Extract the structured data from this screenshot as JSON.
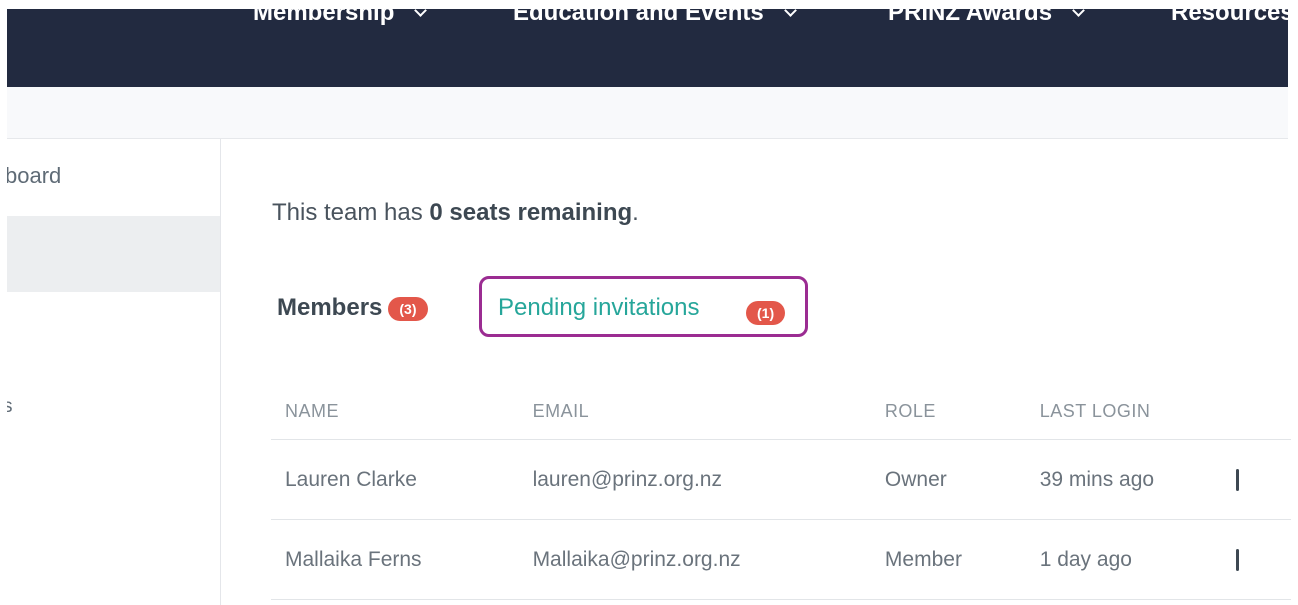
{
  "nav": {
    "items": [
      {
        "label": "Membership"
      },
      {
        "label": "Education and Events"
      },
      {
        "label": "PRINZ Awards"
      },
      {
        "label": "Resources"
      }
    ]
  },
  "sidebar": {
    "items": [
      {
        "label": "board"
      },
      {
        "label": ""
      },
      {
        "label": "s"
      }
    ]
  },
  "team": {
    "seats_prefix": "This team has ",
    "seats_bold": "0 seats remaining",
    "seats_suffix": "."
  },
  "tabs": {
    "members": {
      "label": "Members",
      "count": "(3)"
    },
    "pending": {
      "label": "Pending invitations",
      "count": "(1)"
    }
  },
  "table": {
    "headers": [
      "NAME",
      "EMAIL",
      "ROLE",
      "LAST LOGIN"
    ],
    "rows": [
      {
        "name": "Lauren Clarke",
        "email": "lauren@prinz.org.nz",
        "role": "Owner",
        "last_login": "39 mins ago"
      },
      {
        "name": "Mallaika Ferns",
        "email": "Mallaika@prinz.org.nz",
        "role": "Member",
        "last_login": "1 day ago"
      }
    ]
  },
  "colors": {
    "nav_bg": "#222a40",
    "badge": "#e3574a",
    "pending_tab_text": "#26a69a",
    "highlight_outline": "#9b2c92"
  }
}
